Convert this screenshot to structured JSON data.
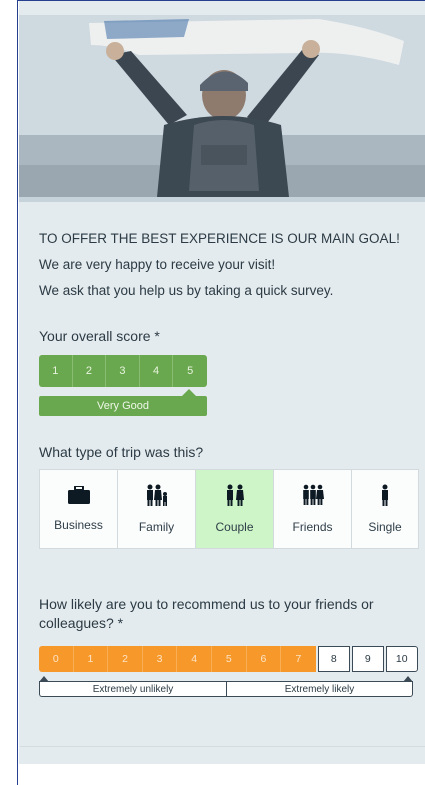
{
  "intro": {
    "headline": "TO OFFER THE BEST EXPERIENCE IS OUR MAIN GOAL!",
    "line1": "We are very happy to receive your visit!",
    "line2": "We ask that you help us by taking a quick survey."
  },
  "overall_score": {
    "question": "Your overall score *",
    "options": [
      "1",
      "2",
      "3",
      "4",
      "5"
    ],
    "selected": "5",
    "selected_label": "Very Good",
    "color": "#6aa84f"
  },
  "trip_type": {
    "question": "What type of trip was this?",
    "options": [
      {
        "label": "Business",
        "icon": "briefcase-icon"
      },
      {
        "label": "Family",
        "icon": "family-icon"
      },
      {
        "label": "Couple",
        "icon": "couple-icon"
      },
      {
        "label": "Friends",
        "icon": "friends-icon"
      },
      {
        "label": "Single",
        "icon": "single-person-icon"
      }
    ],
    "selected": "Couple",
    "selected_color": "#cdf5c8"
  },
  "recommend": {
    "question": "How likely are you to recommend us to your friends or colleagues? *",
    "options": [
      "0",
      "1",
      "2",
      "3",
      "4",
      "5",
      "6",
      "7",
      "8",
      "9",
      "10"
    ],
    "selected": "7",
    "low_label": "Extremely unlikely",
    "high_label": "Extremely likely",
    "color": "#f7982b"
  }
}
